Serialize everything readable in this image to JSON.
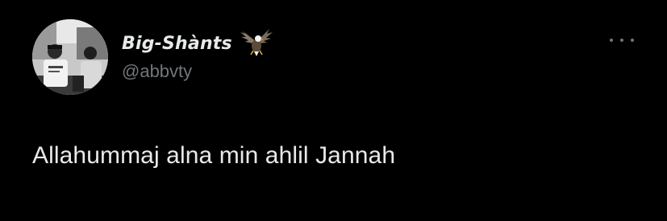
{
  "post": {
    "author": {
      "display_name": "Big-Shànts",
      "handle": "@abbvty",
      "badge_icon": "eagle-icon"
    },
    "more_icon": "more-options-icon",
    "text": "Allahummaj alna min ahlil Jannah"
  },
  "colors": {
    "background": "#000000",
    "primary_text": "#e7e9ea",
    "secondary_text": "#71767b"
  }
}
